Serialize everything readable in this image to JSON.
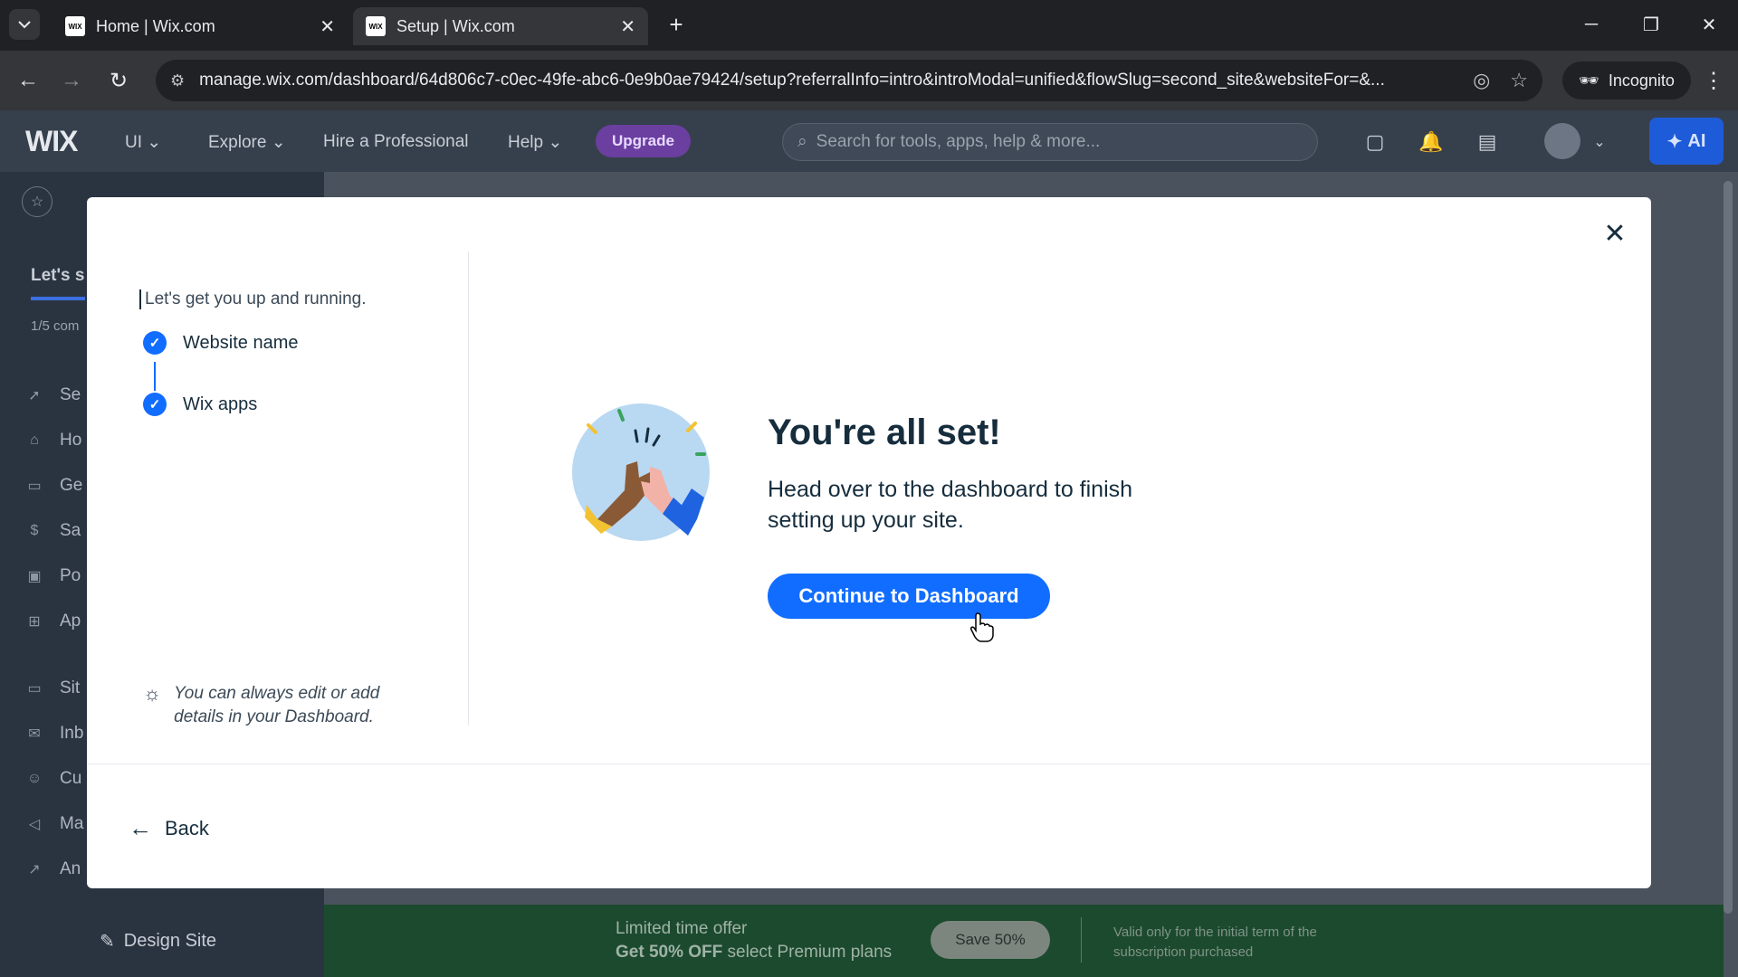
{
  "browser": {
    "tabs": [
      {
        "title": "Home | Wix.com",
        "favicon": "WIX"
      },
      {
        "title": "Setup | Wix.com",
        "favicon": "WIX"
      }
    ],
    "url": "manage.wix.com/dashboard/64d806c7-c0ec-49fe-abc6-0e9b0ae79424/setup?referralInfo=intro&introModal=unified&flowSlug=second_site&websiteFor=&...",
    "incognito_label": "Incognito"
  },
  "header": {
    "logo": "WIX",
    "site_menu": "UI",
    "nav": [
      "Explore",
      "Hire a Professional",
      "Help"
    ],
    "upgrade": "Upgrade",
    "search_placeholder": "Search for tools, apps, help & more...",
    "ai_label": "AI"
  },
  "sidebar": {
    "title": "Let's s",
    "count": "1/5 com",
    "items": [
      {
        "label": "Se",
        "icon": "rocket-icon"
      },
      {
        "label": "Ho",
        "icon": "home-icon"
      },
      {
        "label": "Ge",
        "icon": "document-icon"
      },
      {
        "label": "Sa",
        "icon": "dollar-icon"
      },
      {
        "label": "Po",
        "icon": "briefcase-icon"
      },
      {
        "label": "Ap",
        "icon": "apps-icon"
      },
      {
        "label": "Sit",
        "icon": "site-icon"
      },
      {
        "label": "Inb",
        "icon": "inbox-icon"
      },
      {
        "label": "Cu",
        "icon": "customers-icon"
      },
      {
        "label": "Ma",
        "icon": "megaphone-icon"
      },
      {
        "label": "An",
        "icon": "chart-icon"
      }
    ],
    "design_site": "Design Site"
  },
  "promo": {
    "line1": "Limited time offer",
    "line2_bold": "Get 50% OFF",
    "line2_rest": " select Premium plans",
    "save": "Save 50%",
    "valid": "Valid only for the initial term of the subscription purchased"
  },
  "modal": {
    "intro": "Let's get you up and running.",
    "steps": [
      "Website name",
      "Wix apps"
    ],
    "tip": "You can always edit or add details in your Dashboard.",
    "title": "You're all set!",
    "subtitle": "Head over to the dashboard to finish setting up your site.",
    "cta": "Continue to Dashboard",
    "back": "Back"
  },
  "colors": {
    "accent": "#116dff",
    "upgrade": "#6a3fa0",
    "promo": "#1c4a2e"
  }
}
